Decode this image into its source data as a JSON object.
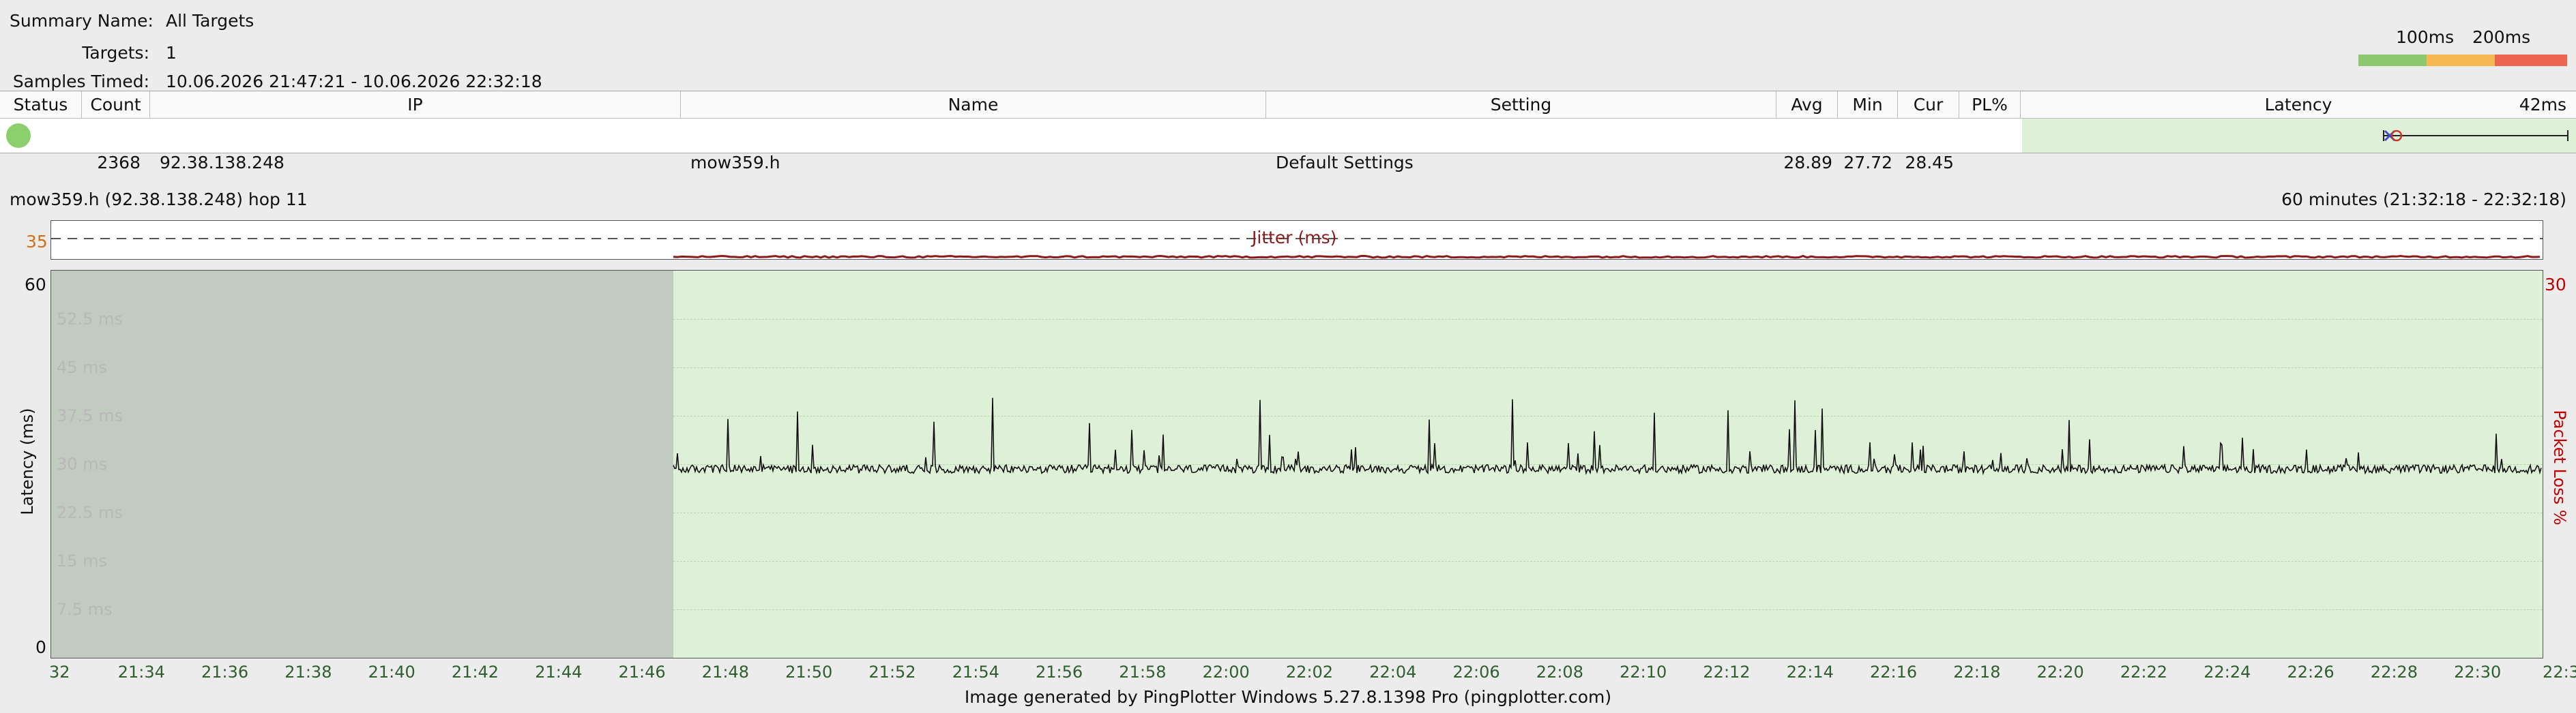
{
  "summary": {
    "name_label": "Summary Name:",
    "name_value": "All Targets",
    "targets_label": "Targets:",
    "targets_value": "1",
    "samples_label": "Samples Timed:",
    "samples_value": "10.06.2026 21:47:21 - 10.06.2026 22:32:18"
  },
  "thresholds": {
    "label_100": "100ms",
    "label_200": "200ms",
    "colors": {
      "good": "#8ec86e",
      "warn": "#f7b954",
      "bad": "#ef6650"
    }
  },
  "table": {
    "headers": {
      "status": "Status",
      "count": "Count",
      "ip": "IP",
      "name": "Name",
      "setting": "Setting",
      "avg": "Avg",
      "min": "Min",
      "cur": "Cur",
      "pl": "PL%",
      "latency": "Latency",
      "latency_scale": "42ms"
    },
    "row": {
      "status_color": "#8ccf6d",
      "count": "2368",
      "ip": "92.38.138.248",
      "name": "mow359.h",
      "setting": "Default Settings",
      "avg": "28.89",
      "min": "27.72",
      "cur": "28.45",
      "pl": ""
    }
  },
  "graph": {
    "title": "mow359.h (92.38.138.248) hop 11",
    "range": "60 minutes (21:32:18 - 22:32:18)",
    "jitter_label": "Jitter (ms)",
    "jitter_value_label": "35",
    "y_axis_label": "Latency (ms)",
    "y_right_label": "Packet Loss %",
    "y_max": "60",
    "y_min": "0",
    "y_right_max": "30",
    "gridlines": [
      "52.5 ms",
      "45 ms",
      "37.5 ms",
      "30 ms",
      "22.5 ms",
      "15 ms",
      "7.5 ms"
    ],
    "x_ticks": [
      "32",
      "21:34",
      "21:36",
      "21:38",
      "21:40",
      "21:42",
      "21:44",
      "21:46",
      "21:48",
      "21:50",
      "21:52",
      "21:54",
      "21:56",
      "21:58",
      "22:00",
      "22:02",
      "22:04",
      "22:06",
      "22:08",
      "22:10",
      "22:12",
      "22:14",
      "22:16",
      "22:18",
      "22:20",
      "22:22",
      "22:24",
      "22:26",
      "22:28",
      "22:30",
      "22:3"
    ],
    "colors": {
      "no_data": "#c2cbc0",
      "plot_bg": "#dff0d8",
      "line": "#111111",
      "jitter": "#8b1a1a",
      "loss_axis": "#c00000"
    }
  },
  "footer": "Image generated by PingPlotter Windows 5.27.8.1398 Pro (pingplotter.com)"
}
